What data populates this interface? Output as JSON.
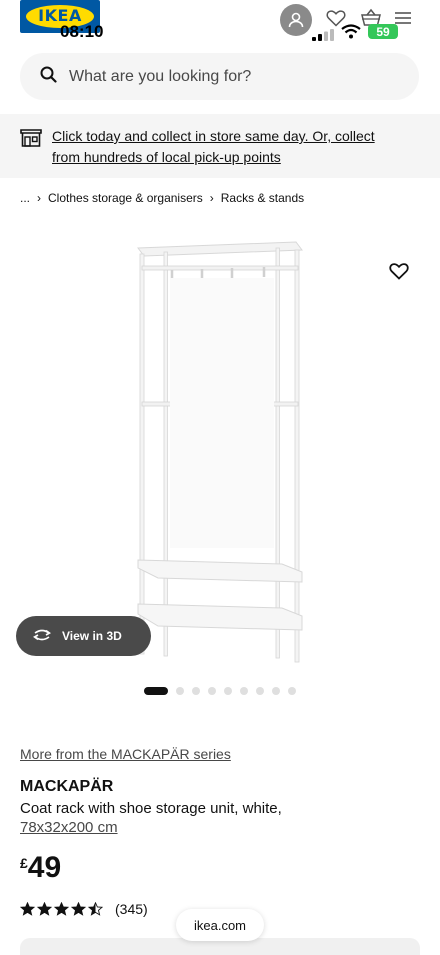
{
  "status_bar": {
    "logo_text": "IKEA",
    "time": "08:10",
    "battery": "59",
    "icons": [
      "avatar-icon",
      "heart-icon",
      "basket-icon",
      "menu-icon",
      "signal-icon",
      "wifi-icon",
      "battery-icon"
    ]
  },
  "search": {
    "placeholder": "What are you looking for?",
    "icon": "search-icon"
  },
  "banner": {
    "icon": "store-icon",
    "text": "Click today and collect in store same day. Or, collect from hundreds of local pick-up points"
  },
  "breadcrumb": {
    "ellipsis": "...",
    "items": [
      "Clothes storage & organisers",
      "Racks & stands"
    ]
  },
  "gallery": {
    "view_3d_label": "View in 3D",
    "image_count": 9,
    "active_index": 0
  },
  "product": {
    "series_link": "More from the MACKAPÄR series",
    "name": "MACKAPÄR",
    "description": "Coat rack with shoe storage unit, white,",
    "size": "78x32x200 cm",
    "currency": "£",
    "price": "49",
    "rating_value": 4.5,
    "rating_count": "(345)"
  },
  "browser": {
    "url": "ikea.com"
  },
  "colors": {
    "ikea_blue": "#0058a3",
    "ikea_yellow": "#ffdb00",
    "battery_green": "#34c759"
  }
}
